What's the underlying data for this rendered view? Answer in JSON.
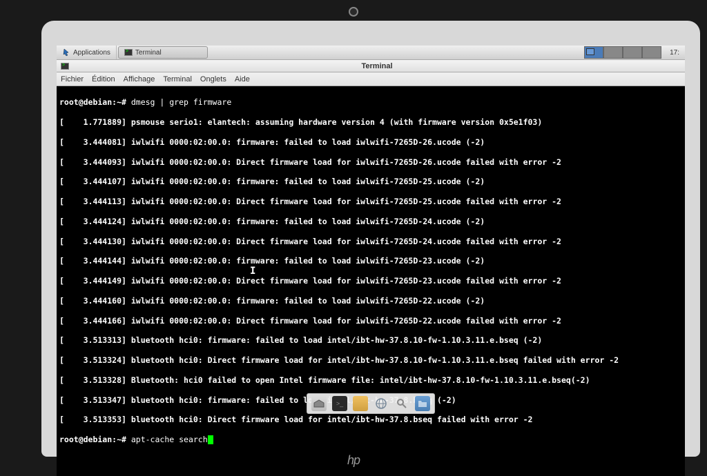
{
  "panel": {
    "applications_label": "Applications",
    "task_label": "Terminal",
    "clock": "17:"
  },
  "window": {
    "title": "Terminal"
  },
  "menubar": {
    "items": [
      "Fichier",
      "Édition",
      "Affichage",
      "Terminal",
      "Onglets",
      "Aide"
    ]
  },
  "terminal": {
    "prompt1": "root@debian:~# ",
    "cmd1": "dmesg | grep firmware",
    "lines": [
      "[    1.771889] psmouse serio1: elantech: assuming hardware version 4 (with firmware version 0x5e1f03)",
      "[    3.444081] iwlwifi 0000:02:00.0: firmware: failed to load iwlwifi-7265D-26.ucode (-2)",
      "[    3.444093] iwlwifi 0000:02:00.0: Direct firmware load for iwlwifi-7265D-26.ucode failed with error -2",
      "[    3.444107] iwlwifi 0000:02:00.0: firmware: failed to load iwlwifi-7265D-25.ucode (-2)",
      "[    3.444113] iwlwifi 0000:02:00.0: Direct firmware load for iwlwifi-7265D-25.ucode failed with error -2",
      "[    3.444124] iwlwifi 0000:02:00.0: firmware: failed to load iwlwifi-7265D-24.ucode (-2)",
      "[    3.444130] iwlwifi 0000:02:00.0: Direct firmware load for iwlwifi-7265D-24.ucode failed with error -2",
      "[    3.444144] iwlwifi 0000:02:00.0: firmware: failed to load iwlwifi-7265D-23.ucode (-2)",
      "[    3.444149] iwlwifi 0000:02:00.0: Direct firmware load for iwlwifi-7265D-23.ucode failed with error -2",
      "[    3.444160] iwlwifi 0000:02:00.0: firmware: failed to load iwlwifi-7265D-22.ucode (-2)",
      "[    3.444166] iwlwifi 0000:02:00.0: Direct firmware load for iwlwifi-7265D-22.ucode failed with error -2",
      "[    3.513313] bluetooth hci0: firmware: failed to load intel/ibt-hw-37.8.10-fw-1.10.3.11.e.bseq (-2)",
      "[    3.513324] bluetooth hci0: Direct firmware load for intel/ibt-hw-37.8.10-fw-1.10.3.11.e.bseq failed with error -2",
      "[    3.513328] Bluetooth: hci0 failed to open Intel firmware file: intel/ibt-hw-37.8.10-fw-1.10.3.11.e.bseq(-2)",
      "[    3.513347] bluetooth hci0: firmware: failed to load intel/ibt-hw-37.8.bseq (-2)",
      "[    3.513353] bluetooth hci0: Direct firmware load for intel/ibt-hw-37.8.bseq failed with error -2"
    ],
    "prompt2": "root@debian:~# ",
    "cmd2": "apt-cache search"
  },
  "dock": {
    "items": [
      "home",
      "terminal",
      "files",
      "web",
      "search",
      "folder"
    ]
  },
  "logo": "hp"
}
